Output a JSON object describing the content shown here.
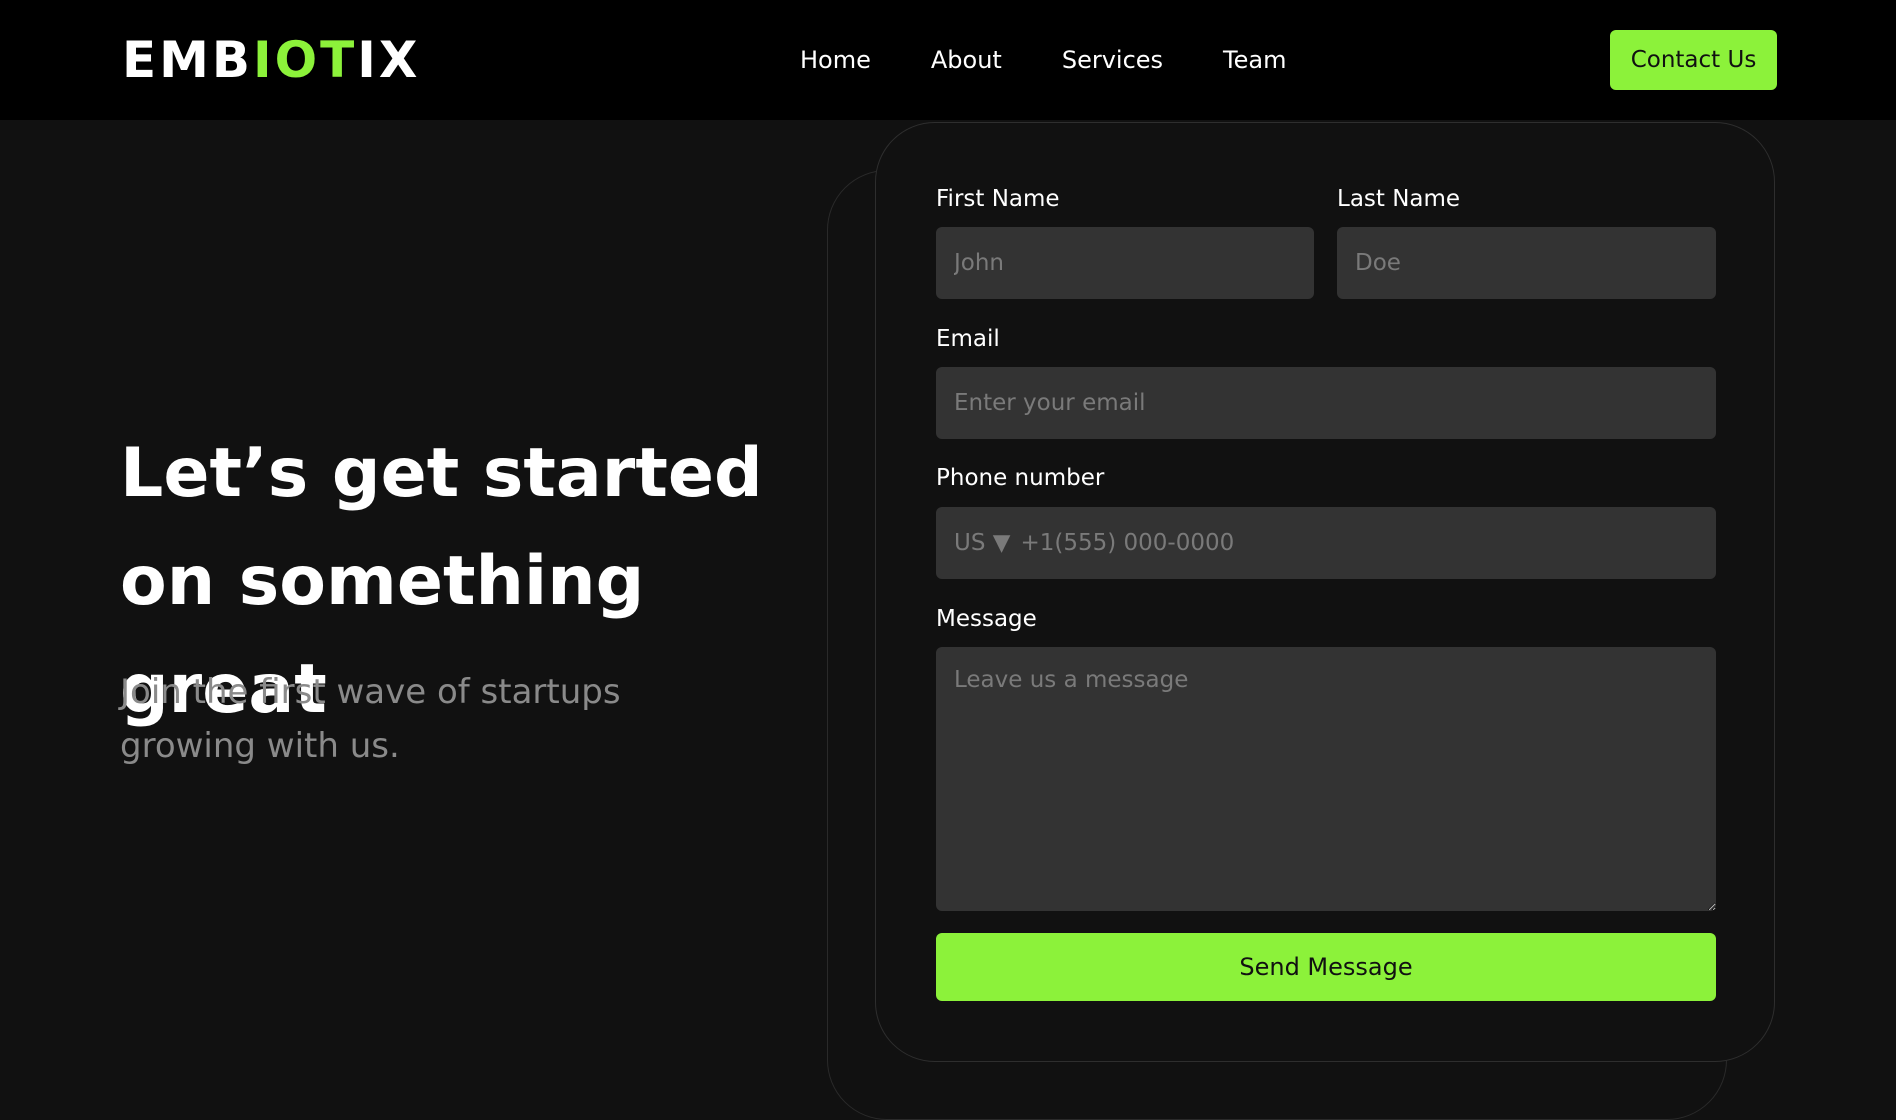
{
  "nav": {
    "logo": {
      "part1": "EMB",
      "part2": "IOT",
      "part3": "IX"
    },
    "links": [
      "Home",
      "About",
      "Services",
      "Team"
    ],
    "contact_label": "Contact Us"
  },
  "hero": {
    "heading": "Let’s get started on something great",
    "subheading": "Join the first wave of startups growing with us."
  },
  "form": {
    "first_name": {
      "label": "First Name",
      "placeholder": "John"
    },
    "last_name": {
      "label": "Last Name",
      "placeholder": "Doe"
    },
    "email": {
      "label": "Email",
      "placeholder": "Enter your email"
    },
    "phone": {
      "label": "Phone number",
      "country": "US ▼",
      "placeholder": "+1(555) 000-0000"
    },
    "message": {
      "label": "Message",
      "placeholder": "Leave us a message"
    },
    "submit_label": "Send Message"
  },
  "colors": {
    "accent": "#8cf23a",
    "background": "#111111",
    "navbar": "#000000",
    "input": "#333333"
  }
}
